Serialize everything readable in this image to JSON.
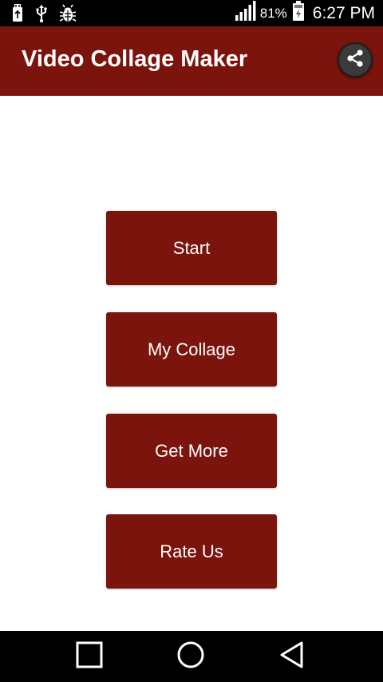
{
  "status_bar": {
    "battery_percent": "81%",
    "time": "6:27 PM",
    "left_icons": [
      "usb-storage-icon",
      "usb-icon",
      "bug-icon"
    ],
    "right_icons": [
      "signal-icon",
      "battery-icon"
    ]
  },
  "app_bar": {
    "title": "Video Collage Maker",
    "share_icon": "share-icon"
  },
  "menu": {
    "start_label": "Start",
    "my_collage_label": "My Collage",
    "get_more_label": "Get More",
    "rate_us_label": "Rate Us"
  },
  "nav_bar": {
    "icons": [
      "recent-apps-icon",
      "home-icon",
      "back-icon"
    ]
  },
  "colors": {
    "accent": "#7b140d",
    "status_bar": "#000000",
    "nav_bar": "#000000",
    "background": "#ffffff"
  }
}
